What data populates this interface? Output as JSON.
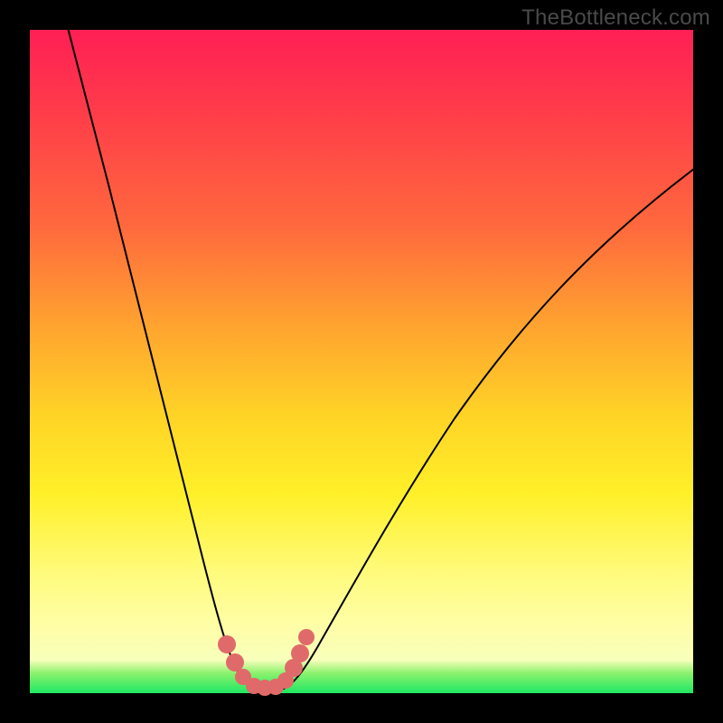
{
  "watermark": "TheBottleneck.com",
  "chart_data": {
    "type": "line",
    "title": "",
    "xlabel": "",
    "ylabel": "",
    "xlim": [
      0,
      100
    ],
    "ylim": [
      0,
      100
    ],
    "grid": false,
    "legend": false,
    "series": [
      {
        "name": "bottleneck-curve",
        "description": "V-shaped bottleneck curve; y≈0 near x≈34, rising steeply toward both ends",
        "x_estimated": [
          5,
          10,
          15,
          20,
          25,
          28,
          30,
          32,
          34,
          36,
          40,
          45,
          50,
          55,
          60,
          70,
          80,
          90,
          100
        ],
        "y_estimated": [
          100,
          80,
          58,
          38,
          20,
          10,
          5,
          2,
          0,
          2,
          8,
          18,
          28,
          37,
          45,
          58,
          68,
          75,
          80
        ]
      }
    ],
    "annotations": {
      "markers_description": "Cluster of small salmon-colored dots at the trough of the curve",
      "markers_x_estimated": [
        29,
        30.5,
        31.5,
        33,
        34.5,
        36,
        37,
        38,
        39
      ],
      "markers_y_estimated": [
        6,
        3,
        2,
        1,
        1,
        2,
        3,
        5,
        7
      ]
    },
    "background_gradient": {
      "top": "#ff1f55",
      "upper_mid": "#ffa52f",
      "mid": "#fff028",
      "lower": "#fffea8",
      "bottom": "#1fe763"
    }
  }
}
